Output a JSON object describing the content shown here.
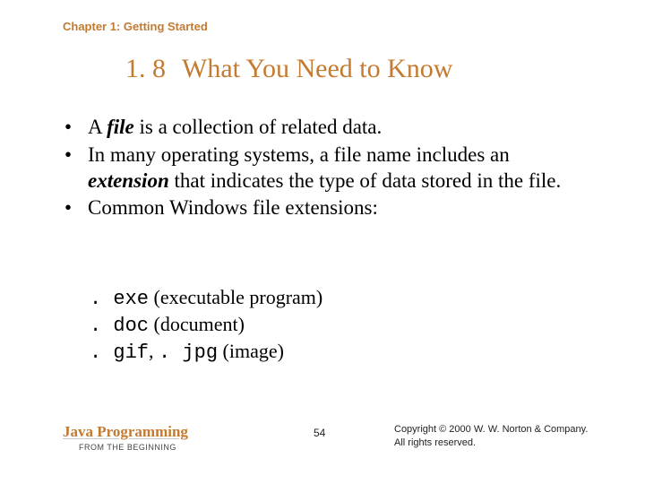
{
  "chapter_header": "Chapter 1: Getting Started",
  "section": {
    "number": "1. 8",
    "title": "What You Need to Know"
  },
  "bullets": [
    {
      "pre": "A ",
      "em": "file",
      "post": " is a collection of related data."
    },
    {
      "pre": "In many operating systems, a file name includes an ",
      "em": "extension",
      "post": " that indicates the type of data stored in the file."
    },
    {
      "pre": "Common Windows file extensions:",
      "em": "",
      "post": ""
    }
  ],
  "extensions": [
    {
      "code": ". exe",
      "desc": " (executable program)"
    },
    {
      "code": ". doc",
      "desc": " (document)"
    },
    {
      "code": ". gif",
      "desc2_code": ". jpg",
      "sep": ", ",
      "desc": " (image)"
    }
  ],
  "footer": {
    "book_main": "Java Programming",
    "book_sub": "FROM THE BEGINNING",
    "page_number": "54",
    "copyright_line1": "Copyright © 2000 W. W. Norton & Company.",
    "copyright_line2": "All rights reserved."
  }
}
